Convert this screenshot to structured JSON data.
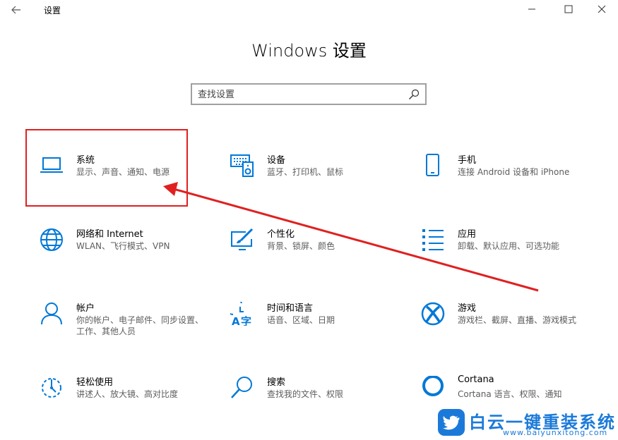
{
  "window": {
    "title": "设置"
  },
  "heading": "Windows 设置",
  "search": {
    "placeholder": "查找设置"
  },
  "tiles": [
    {
      "title": "系统",
      "desc": "显示、声音、通知、电源",
      "icon": "laptop-icon"
    },
    {
      "title": "设备",
      "desc": "蓝牙、打印机、鼠标",
      "icon": "devices-icon"
    },
    {
      "title": "手机",
      "desc": "连接 Android 设备和 iPhone",
      "icon": "phone-icon"
    },
    {
      "title": "网络和 Internet",
      "desc": "WLAN、飞行模式、VPN",
      "icon": "globe-icon"
    },
    {
      "title": "个性化",
      "desc": "背景、锁屏、颜色",
      "icon": "paint-icon"
    },
    {
      "title": "应用",
      "desc": "卸载、默认应用、可选功能",
      "icon": "apps-list-icon"
    },
    {
      "title": "帐户",
      "desc": "你的帐户、电子邮件、同步设置、工作、其他人员",
      "icon": "person-icon"
    },
    {
      "title": "时间和语言",
      "desc": "语音、区域、日期",
      "icon": "time-language-icon"
    },
    {
      "title": "游戏",
      "desc": "游戏栏、截屏、直播、游戏模式",
      "icon": "xbox-icon"
    },
    {
      "title": "轻松使用",
      "desc": "讲述人、放大镜、高对比度",
      "icon": "ease-of-access-icon"
    },
    {
      "title": "搜索",
      "desc": "查找我的文件、权限",
      "icon": "search-icon"
    },
    {
      "title": "Cortana",
      "desc": "Cortana 语言、权限、通知",
      "icon": "cortana-icon"
    }
  ],
  "colors": {
    "accent": "#0078d7",
    "annotation": "#e02020",
    "watermark": "#1b7ad9"
  },
  "watermark": {
    "title": "白云一键重装系统",
    "url": "www.baiyunxitong.com"
  }
}
